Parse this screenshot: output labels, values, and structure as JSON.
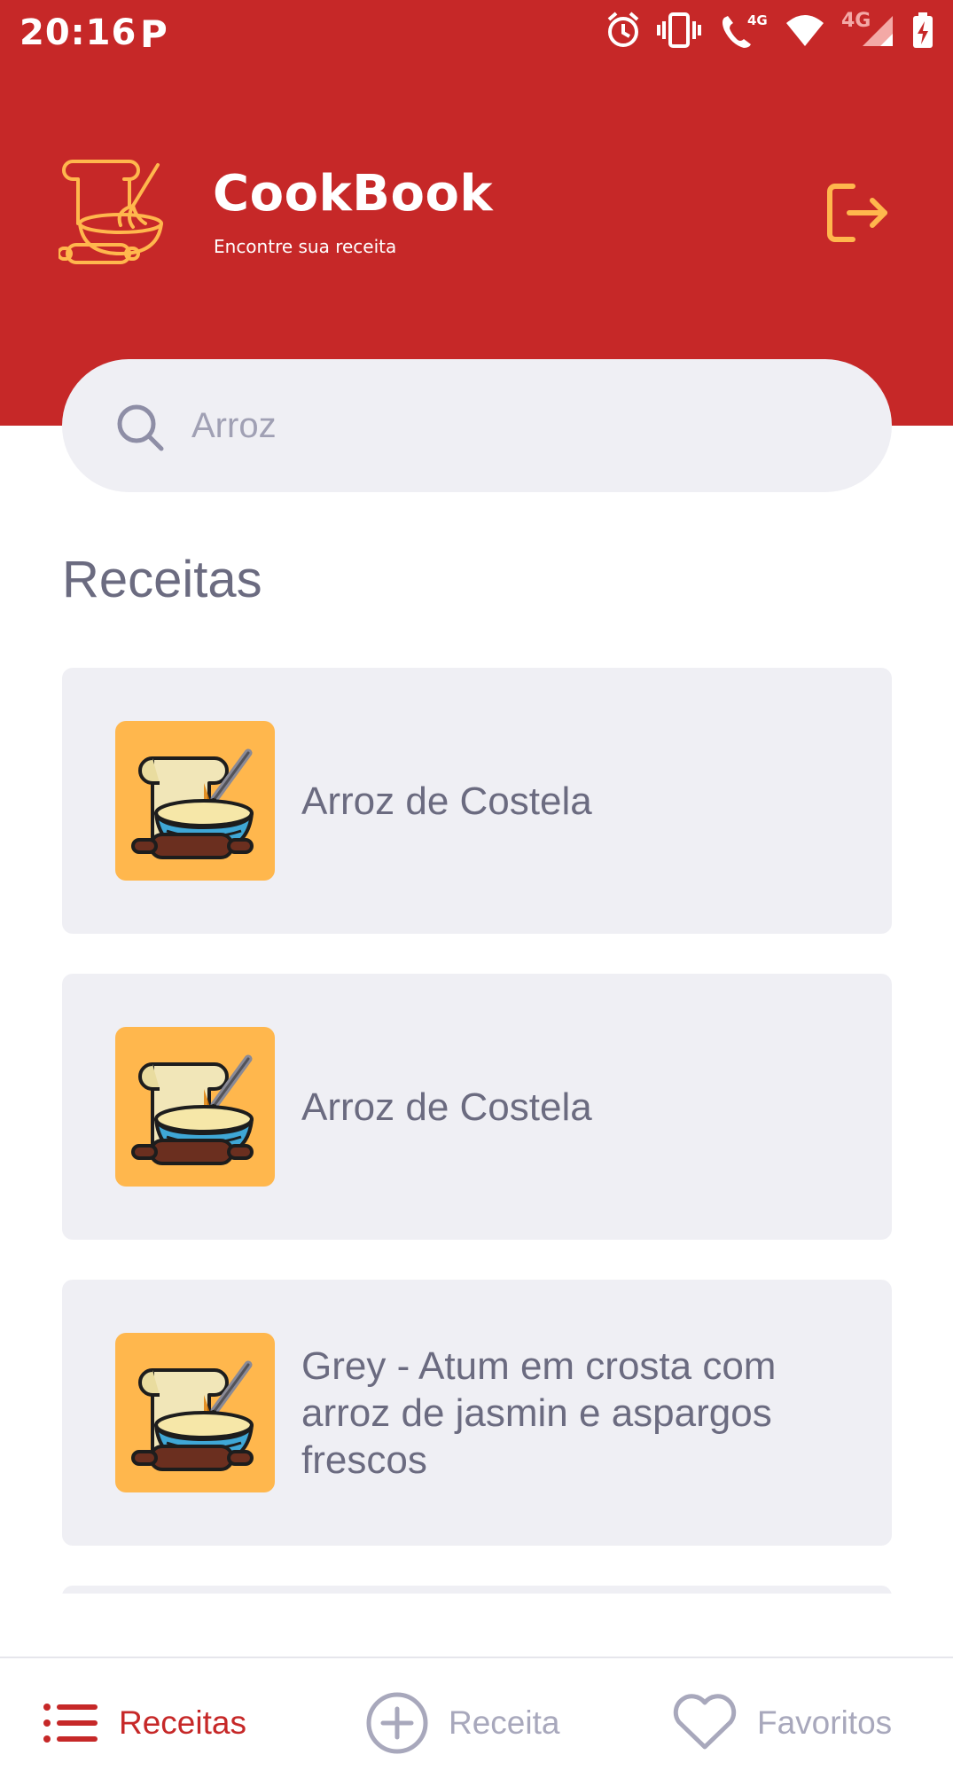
{
  "status_bar": {
    "time": "20:16",
    "notification_letter": "P",
    "network_label_1": "4G",
    "network_label_2": "4G"
  },
  "header": {
    "app_title": "CookBook",
    "app_subtitle": "Encontre sua receita",
    "logo_icon": "cookbook-logo-icon",
    "logout_icon": "logout-icon",
    "background_color": "#c62828",
    "accent_color": "#ffb74d"
  },
  "search": {
    "value": "Arroz",
    "icon": "search-icon"
  },
  "section": {
    "title": "Receitas"
  },
  "recipes": [
    {
      "name": "Arroz de Costela"
    },
    {
      "name": "Arroz de Costela"
    },
    {
      "name": "Grey - Atum em crosta com arroz de jasmin e aspargos frescos"
    }
  ],
  "bottom_nav": {
    "items": [
      {
        "label": "Receitas",
        "icon": "list-icon",
        "active": true
      },
      {
        "label": "Receita",
        "icon": "add-circle-icon",
        "active": false
      },
      {
        "label": "Favoritos",
        "icon": "heart-icon",
        "active": false
      }
    ]
  }
}
